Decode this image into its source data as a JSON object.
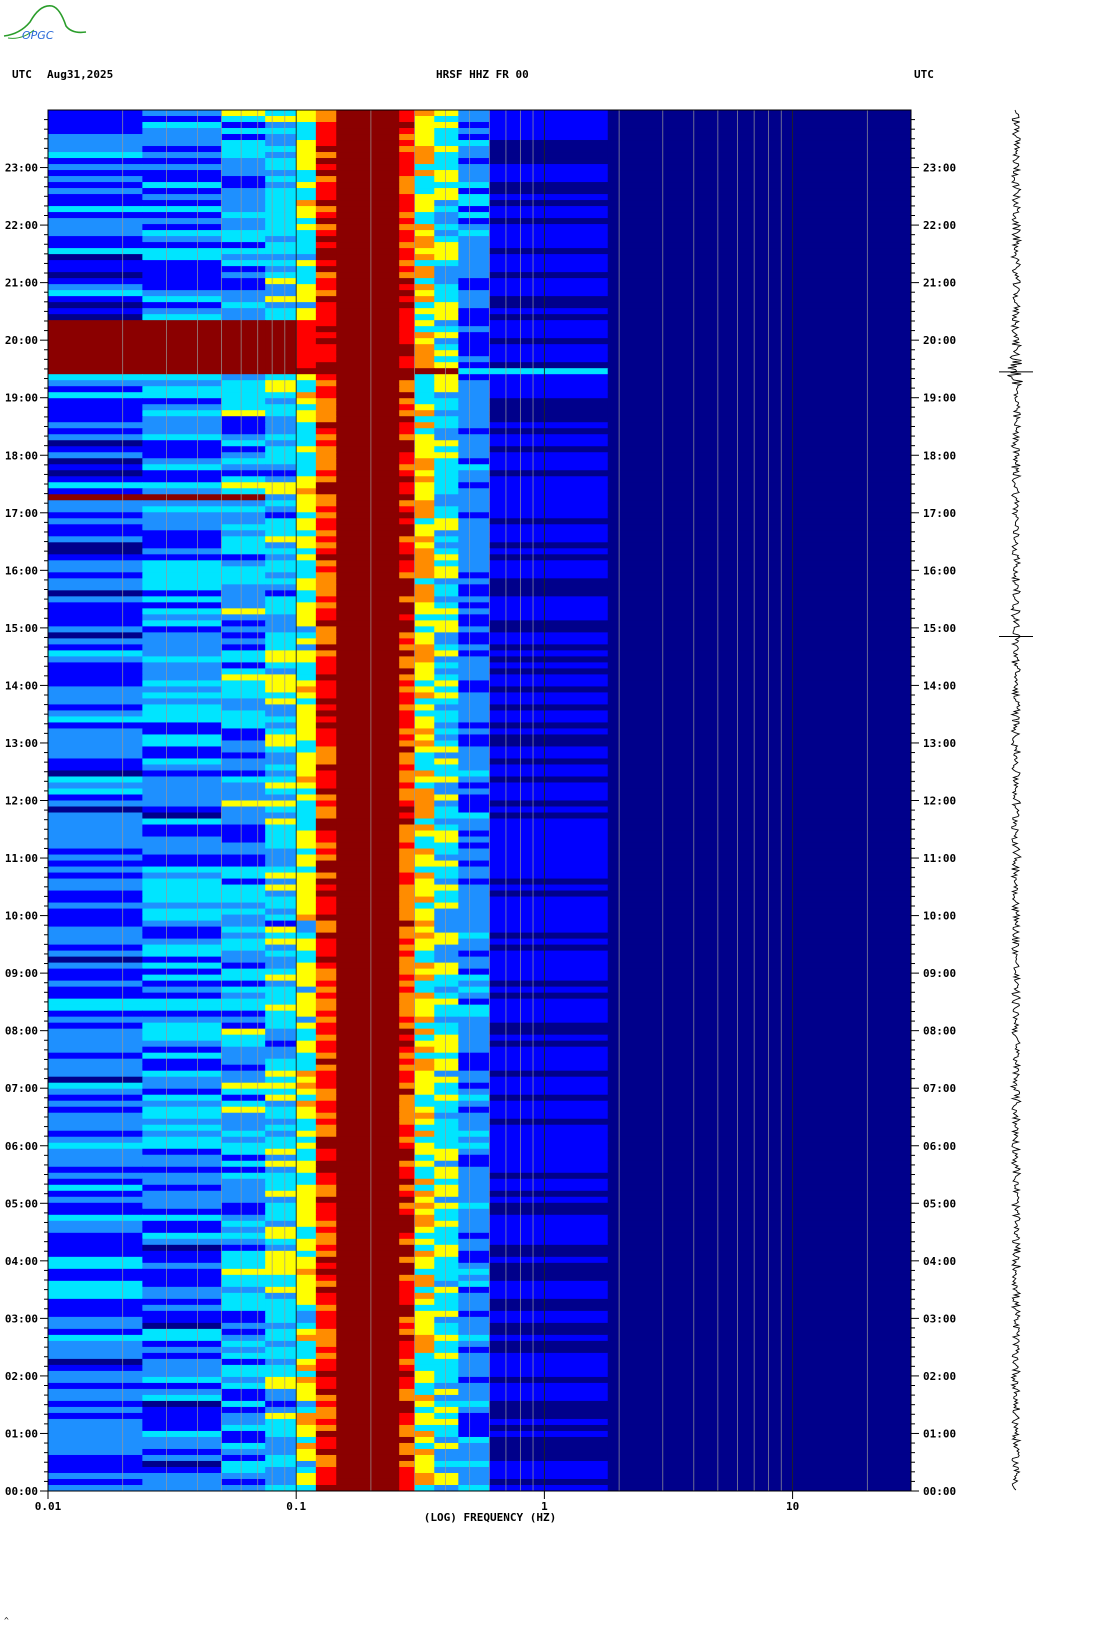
{
  "header": {
    "left_tz": "UTC",
    "date": "Aug31,2025",
    "station": "HRSF HHZ FR 00",
    "right_tz": "UTC"
  },
  "logo": {
    "text": "OPGC",
    "color": "#2a9d2a"
  },
  "corner_mark": "^",
  "chart_data": {
    "type": "heatmap",
    "title": "HRSF HHZ FR 00",
    "xlabel": "(LOG) FREQUENCY (HZ)",
    "ylabel": "",
    "x_scale": "log",
    "xlim": [
      0.01,
      30
    ],
    "x_ticks": [
      0.01,
      0.1,
      1,
      10
    ],
    "x_tick_labels": [
      "0.01",
      "0.1",
      "1",
      "10"
    ],
    "ylim_hours": [
      0,
      24
    ],
    "y_tick_labels": [
      "00:00",
      "01:00",
      "02:00",
      "03:00",
      "04:00",
      "05:00",
      "06:00",
      "07:00",
      "08:00",
      "09:00",
      "10:00",
      "11:00",
      "12:00",
      "13:00",
      "14:00",
      "15:00",
      "16:00",
      "17:00",
      "18:00",
      "19:00",
      "20:00",
      "21:00",
      "22:00",
      "23:00"
    ],
    "colormap": [
      "#00008b",
      "#0000ff",
      "#1e90ff",
      "#00e5ff",
      "#ffff00",
      "#ff8c00",
      "#ff0000",
      "#8b0000"
    ],
    "features": {
      "microseism_band_hz": [
        0.12,
        0.3
      ],
      "event_time_h": 19.45,
      "strong_lowfreq_window_h": [
        19.5,
        20.4
      ],
      "lowfreq_burst_time_h": 17.3,
      "trace_spikes_h": [
        19.45,
        14.85
      ]
    }
  }
}
